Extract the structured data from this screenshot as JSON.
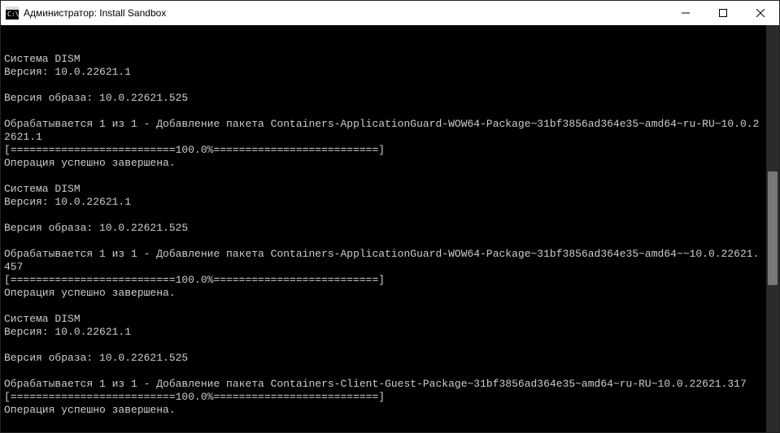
{
  "titlebar": {
    "title": "Администратор:  Install Sandbox",
    "icon_name": "cmd-icon"
  },
  "win_controls": {
    "minimize": "minimize",
    "maximize": "maximize",
    "close": "close"
  },
  "console": {
    "lines": [
      "Cистема DISM",
      "Версия: 10.0.22621.1",
      "",
      "Версия образа: 10.0.22621.525",
      "",
      "Обрабатывается 1 из 1 - Добавление пакета Containers-ApplicationGuard-WOW64-Package~31bf3856ad364e35~amd64~ru-RU~10.0.22621.1",
      "[==========================100.0%==========================]",
      "Операция успешно завершена.",
      "",
      "Cистема DISM",
      "Версия: 10.0.22621.1",
      "",
      "Версия образа: 10.0.22621.525",
      "",
      "Обрабатывается 1 из 1 - Добавление пакета Containers-ApplicationGuard-WOW64-Package~31bf3856ad364e35~amd64~~10.0.22621.457",
      "[==========================100.0%==========================]",
      "Операция успешно завершена.",
      "",
      "Cистема DISM",
      "Версия: 10.0.22621.1",
      "",
      "Версия образа: 10.0.22621.525",
      "",
      "Обрабатывается 1 из 1 - Добавление пакета Containers-Client-Guest-Package~31bf3856ad364e35~amd64~ru-RU~10.0.22621.317",
      "[==========================100.0%==========================]",
      "Операция успешно завершена."
    ]
  }
}
